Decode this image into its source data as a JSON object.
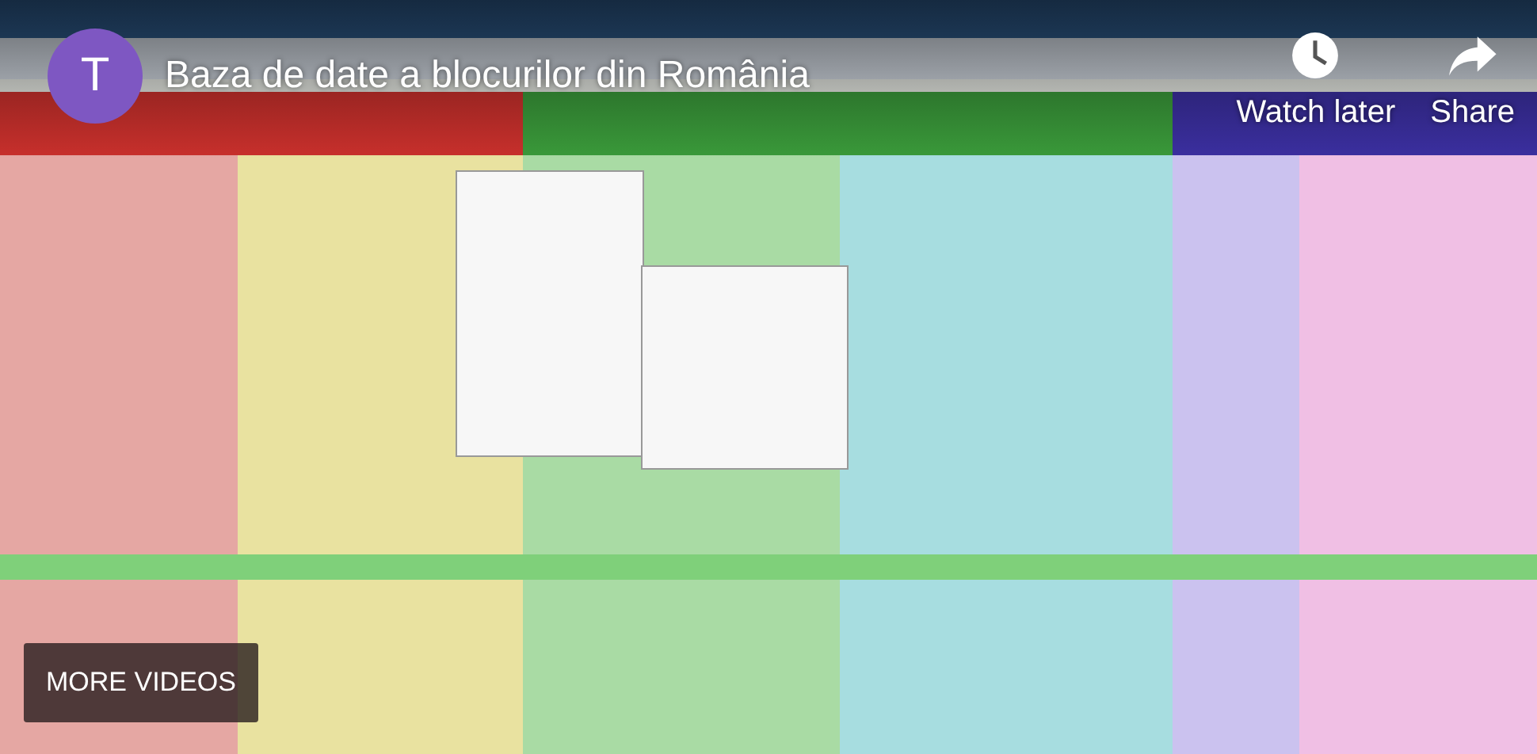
{
  "channel": {
    "avatar_letter": "T"
  },
  "video": {
    "title": "Baza de date a blocurilor din România",
    "kind": "picture"
  },
  "actions": [
    {
      "kind": "watch_later",
      "label": "Watch later"
    },
    {
      "kind": "share",
      "label": "Share"
    }
  ],
  "more_videos": {
    "label": "MORE VIDEOS"
  }
}
